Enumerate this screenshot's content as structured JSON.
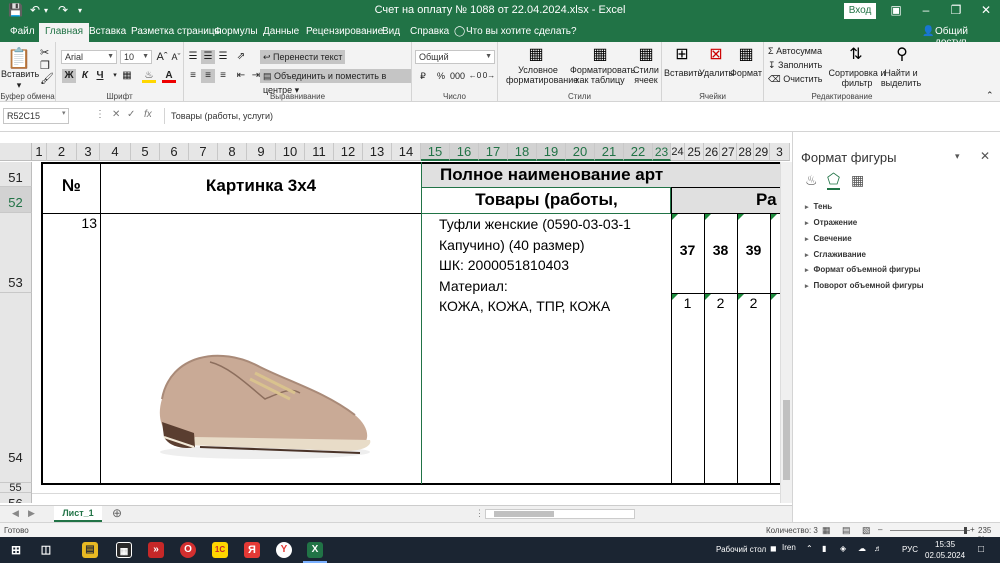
{
  "window": {
    "title": "Счет на оплату № 1088 от 22.04.2024.xlsx  -  Excel",
    "signin": "Вход"
  },
  "tabs": [
    "Файл",
    "Главная",
    "Вставка",
    "Разметка страницы",
    "Формулы",
    "Данные",
    "Рецензирование",
    "Вид",
    "Справка",
    "Что вы хотите сделать?"
  ],
  "share": "Общий доступ",
  "ribbon": {
    "clipboard": {
      "paste": "Вставить",
      "label": "Буфер обмена"
    },
    "font": {
      "name": "Arial",
      "size": "10",
      "label": "Шрифт",
      "bold": "Ж",
      "italic": "К",
      "underline": "Ч"
    },
    "alignment": {
      "wrap": "Перенести текст",
      "merge": "Объединить и поместить в центре",
      "label": "Выравнивание"
    },
    "number": {
      "format": "Общий",
      "label": "Число"
    },
    "styles": {
      "cond": "Условное форматирование",
      "table": "Форматировать как таблицу",
      "cell": "Стили ячеек",
      "label": "Стили"
    },
    "cells": {
      "insert": "Вставить",
      "delete": "Удалить",
      "format": "Формат",
      "label": "Ячейки"
    },
    "editing": {
      "autosum": "Автосумма",
      "fill": "Заполнить",
      "clear": "Очистить",
      "sort": "Сортировка и фильтр",
      "find": "Найти и выделить",
      "label": "Редактирование"
    }
  },
  "formula_bar": {
    "namebox": "R52C15",
    "fx": "fx",
    "content": "Товары (работы, услуги)"
  },
  "columns": [
    "1",
    "2",
    "3",
    "4",
    "5",
    "6",
    "7",
    "8",
    "9",
    "10",
    "11",
    "12",
    "13",
    "14",
    "15",
    "16",
    "17",
    "18",
    "19",
    "20",
    "21",
    "22",
    "23",
    "24",
    "25",
    "26",
    "27",
    "28",
    "29",
    "3"
  ],
  "rows": [
    "51",
    "52",
    "53",
    "54",
    "55",
    "56"
  ],
  "sheet": {
    "num_header": "№",
    "picture_header": "Картинка 3х4",
    "full_name_header": "Полное наименование арт",
    "goods_header": "Товары (работы,",
    "ra_header": "Ра",
    "row_number": "13",
    "desc_lines": [
      "Туфли женские (0590-03-03-1",
      "Капучино) (40 размер)",
      "ШК: 2000051810403",
      "Материал:",
      "КОЖА, КОЖА, ТПР, КОЖА"
    ],
    "sizes": [
      "37",
      "38",
      "39"
    ],
    "qty": [
      "1",
      "2",
      "2"
    ]
  },
  "task_pane": {
    "title": "Формат фигуры",
    "items": [
      "Тень",
      "Отражение",
      "Свечение",
      "Сглаживание",
      "Формат объемной фигуры",
      "Поворот объемной фигуры"
    ]
  },
  "sheet_tab": "Лист_1",
  "status": {
    "ready": "Готово",
    "count": "Количество: 3",
    "zoom": "235 %"
  },
  "taskbar": {
    "desktop": "Рабочий стол",
    "user": "Iren",
    "lang": "РУС",
    "time": "15:35",
    "date": "02.05.2024"
  },
  "colors": {
    "excel_green": "#217346",
    "accent_green": "#1d8a3d"
  }
}
